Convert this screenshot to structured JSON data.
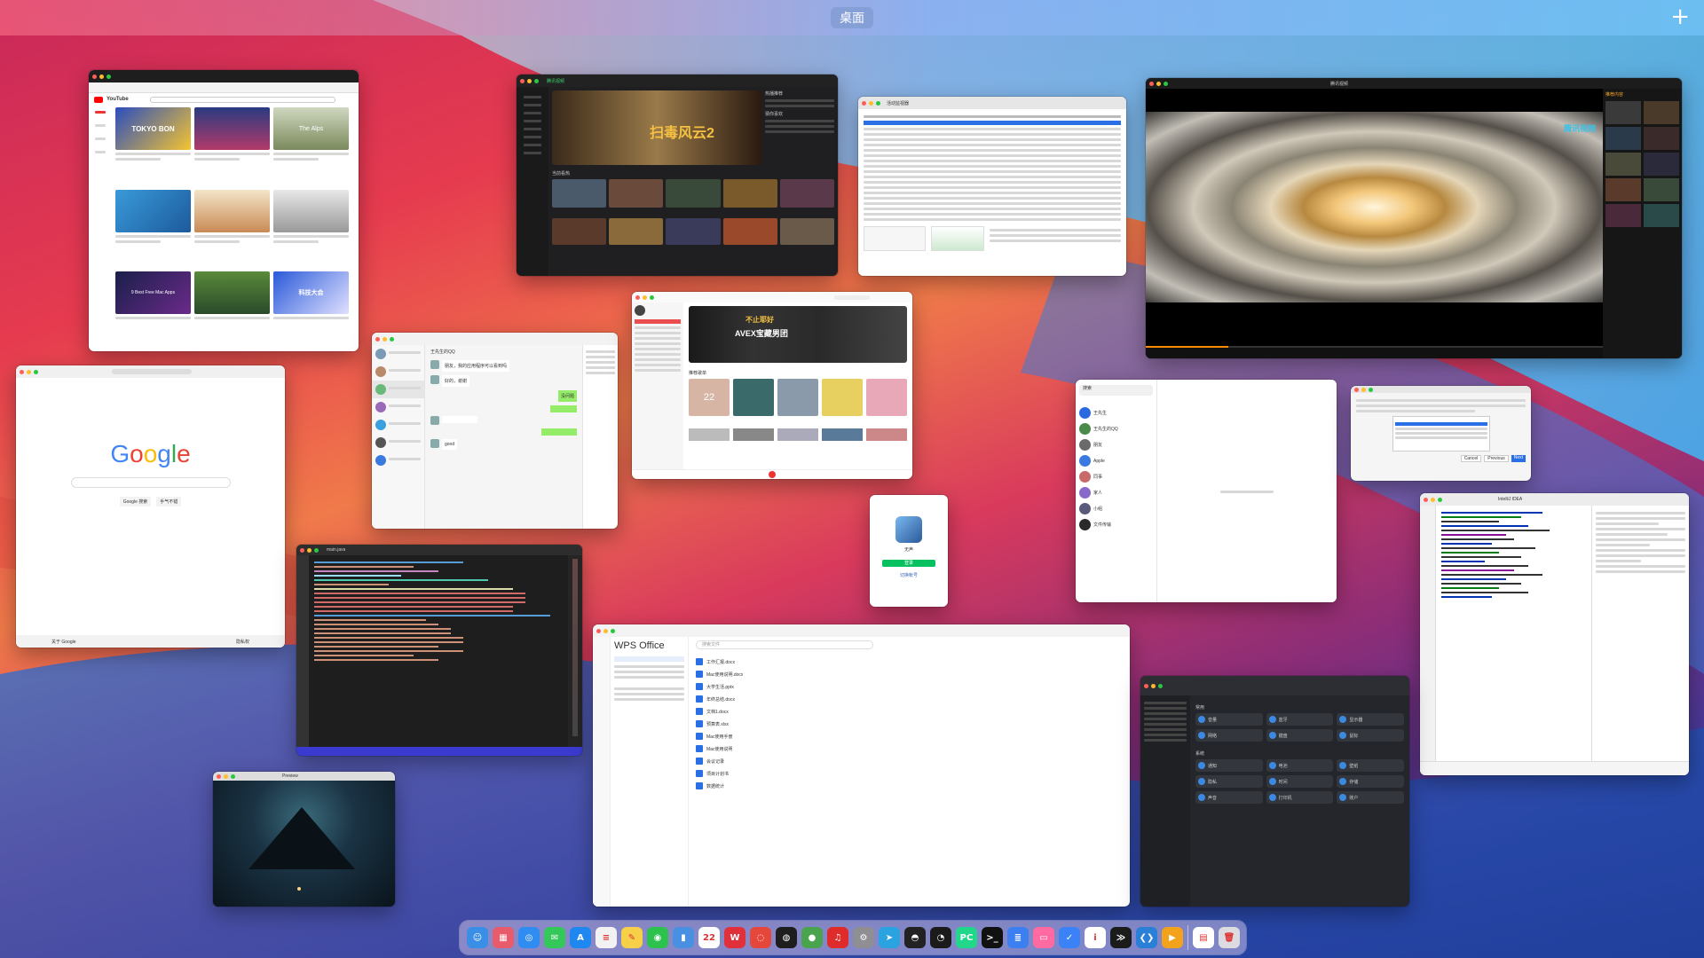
{
  "mission_control": {
    "space_label": "桌面",
    "add_space": "+"
  },
  "windows": {
    "youtube": {
      "logo": "YouTube",
      "thumb_text_1": "TOKYO BON",
      "thumb_text_2": "The Alps",
      "thumb_text_3": "9 Best Free Mac Apps",
      "thumb_text_4": "科技大会"
    },
    "video_app": {
      "title": "腾讯视频",
      "banner": "扫毒风云2",
      "section": "当前看热",
      "side_title_1": "热播推荐",
      "side_title_2": "猜你喜欢"
    },
    "table_app": {
      "title": "活动监视器"
    },
    "player": {
      "title": "腾讯视频",
      "badge": "腾讯视频",
      "side_header": "推荐内容"
    },
    "chat": {
      "title": "王先生的QQ",
      "msg_1": "朋友，我的应用程序可以看到吗",
      "msg_2": "好的，谢谢",
      "msg_3": "没问题",
      "msg_4": "good"
    },
    "music": {
      "banner_line_1": "不止耶好",
      "banner_line_2": "AVEX宝藏男团",
      "section": "推荐歌单",
      "calendar_day": "22"
    },
    "google": {
      "logo_parts": [
        "G",
        "o",
        "o",
        "g",
        "l",
        "e"
      ],
      "btn_search": "Google 搜索",
      "btn_lucky": "手气不错",
      "footer_left": "关于 Google",
      "footer_right": "隐私权"
    },
    "code": {
      "title": "main.java"
    },
    "qq_login": {
      "name": "无声",
      "login_btn": "登录",
      "switch": "切换帐号"
    },
    "im_list": {
      "search_placeholder": "搜索",
      "contacts": [
        "王先生",
        "王先生的QQ",
        "朋友",
        "Apple",
        "同事",
        "家人",
        "小组",
        "文件传输"
      ]
    },
    "dialog": {
      "buttons": [
        "Cancel",
        "Previous",
        "Next"
      ]
    },
    "wps": {
      "title": "WPS Office",
      "search_placeholder": "搜索文件",
      "files": [
        "工作汇报.docx",
        "Mac使用说明.docx",
        "大学生活.pptx",
        "年终总结.docx",
        "文档1.docx",
        "预算表.xlsx",
        "Mac使用手册",
        "Mac使用说明",
        "会议记录",
        "项目计划书",
        "数据统计"
      ]
    },
    "settings": {
      "section_1": "常用",
      "section_2": "系统",
      "items": [
        "音量",
        "蓝牙",
        "显示器",
        "网络",
        "键盘",
        "鼠标",
        "通知",
        "电池",
        "壁纸",
        "隐私",
        "时间",
        "存储",
        "声音",
        "打印机",
        "账户"
      ]
    },
    "ide": {
      "title": "IntelliJ IDEA"
    },
    "photo": {
      "title": "Preview"
    }
  },
  "dock": {
    "icons": [
      {
        "name": "finder-icon",
        "glyph": "☺",
        "color": "#3a8ee6"
      },
      {
        "name": "launchpad-icon",
        "glyph": "▦",
        "color": "#e85b6b"
      },
      {
        "name": "safari-icon",
        "glyph": "◎",
        "color": "#2f8cf0"
      },
      {
        "name": "messages-icon",
        "glyph": "✉",
        "color": "#34c759"
      },
      {
        "name": "appstore-icon",
        "glyph": "A",
        "color": "#1e88f0"
      },
      {
        "name": "reminders-icon",
        "glyph": "≡",
        "color": "#f2f2f2"
      },
      {
        "name": "notes-icon",
        "glyph": "✎",
        "color": "#f7d04a"
      },
      {
        "name": "wechat-icon",
        "glyph": "◉",
        "color": "#2dc24e"
      },
      {
        "name": "voice-memo-icon",
        "glyph": "▮",
        "color": "#4a90e2"
      },
      {
        "name": "calendar-icon",
        "glyph": "22",
        "color": "#ffffff"
      },
      {
        "name": "wps-icon",
        "glyph": "W",
        "color": "#e0303a"
      },
      {
        "name": "weibo-icon",
        "glyph": "◌",
        "color": "#e6473b"
      },
      {
        "name": "qq-icon",
        "glyph": "◍",
        "color": "#1e1e1e"
      },
      {
        "name": "chrome-icon",
        "glyph": "●",
        "color": "#4aa34d"
      },
      {
        "name": "netease-music-icon",
        "glyph": "♫",
        "color": "#e02b2b"
      },
      {
        "name": "settings-icon",
        "glyph": "⚙",
        "color": "#8e8e93"
      },
      {
        "name": "telegram-icon",
        "glyph": "➤",
        "color": "#2aa3e0"
      },
      {
        "name": "github-icon",
        "glyph": "◓",
        "color": "#222"
      },
      {
        "name": "activity-monitor-icon",
        "glyph": "◔",
        "color": "#1b1b1b"
      },
      {
        "name": "pycharm-icon",
        "glyph": "PC",
        "color": "#21d789"
      },
      {
        "name": "terminal-icon",
        "glyph": ">_",
        "color": "#111"
      },
      {
        "name": "text-editor-icon",
        "glyph": "≣",
        "color": "#3b7ff0"
      },
      {
        "name": "screen-share-icon",
        "glyph": "▭",
        "color": "#ff6aa2"
      },
      {
        "name": "mail-icon",
        "glyph": "✓",
        "color": "#3b82f6"
      },
      {
        "name": "info-icon",
        "glyph": "i",
        "color": "#ffffff"
      },
      {
        "name": "console-icon",
        "glyph": "≫",
        "color": "#1b1b1b"
      },
      {
        "name": "vscode-icon",
        "glyph": "❮❯",
        "color": "#2a7fd6"
      },
      {
        "name": "infuse-icon",
        "glyph": "▶",
        "color": "#f2a31b"
      },
      {
        "name": "document-icon",
        "glyph": "▤",
        "color": "#ffffff"
      },
      {
        "name": "trash-icon",
        "glyph": "🗑",
        "color": "#dcdce0"
      }
    ]
  }
}
